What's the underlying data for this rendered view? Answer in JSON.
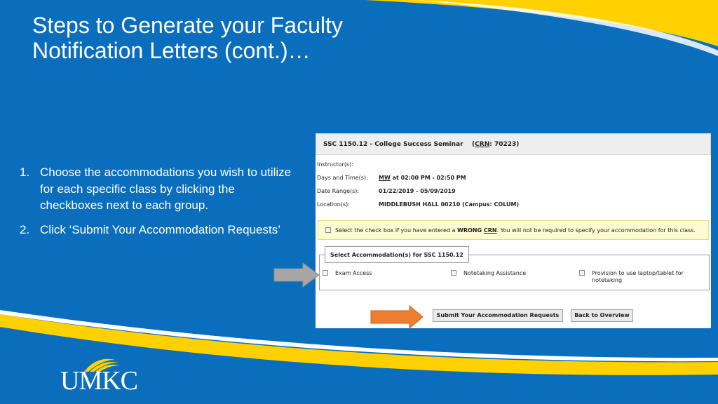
{
  "slide": {
    "title": "Steps to Generate your Faculty Notification Letters (cont.)…",
    "steps": [
      {
        "num": "1.",
        "text": "Choose the accommodations you wish to utilize for each specific class by clicking the checkboxes next to each group."
      },
      {
        "num": "2.",
        "text": "Click ‘Submit Your Accommodation Requests’"
      }
    ]
  },
  "screenshot": {
    "course_prefix": "SSC 1150.12 - College Success Seminar",
    "crn_label": "CRN",
    "crn_value": ": 70223)",
    "instructor_label": "Instructor(s):",
    "days_label": "Days and Time(s):",
    "days_day": "MW",
    "days_time": " at 02:00 PM - 02:50 PM",
    "range_label": "Date Range(s):",
    "range_value": "01/22/2019 - 05/09/2019",
    "location_label": "Location(s):",
    "location_value": "MIDDLEBUSH HALL 00210 (Campus: COLUM)",
    "warning_pre": "Select the check box if you have entered a ",
    "warning_bold": "WRONG ",
    "warning_crn": "CRN",
    "warning_post": ". You will not be required to specify your accommodation for this class.",
    "legend": "Select Accommodation(s) for SSC 1150.12",
    "accommodations": [
      "Exam Access",
      "Notetaking Assistance",
      "Provision to use laptop/tablet for notetaking"
    ],
    "submit_label": "Submit Your Accommodation Requests",
    "back_label": "Back to Overview"
  },
  "branding": {
    "logo_text": "UMKC",
    "colors": {
      "background": "#0a6ebd",
      "accent": "#ffd100",
      "arrow_gray": "#a6a6a6",
      "arrow_orange": "#ed7d31"
    }
  },
  "icons": [
    "gray-arrow-icon",
    "orange-arrow-icon",
    "checkbox-icon",
    "umkc-logo-icon"
  ]
}
